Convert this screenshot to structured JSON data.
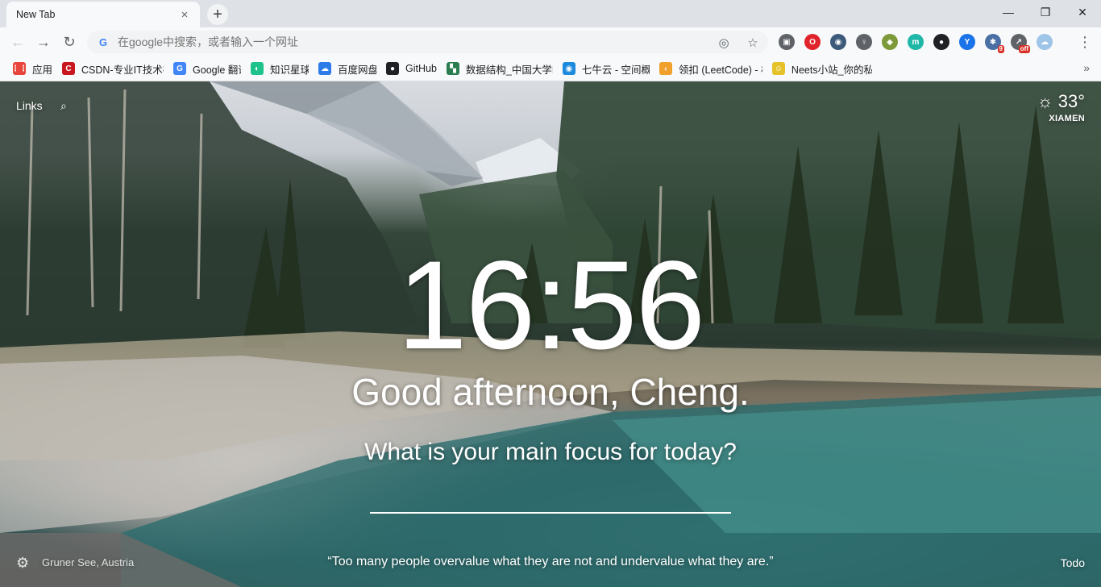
{
  "tab": {
    "title": "New Tab",
    "close_icon": "×",
    "new_tab_icon": "+"
  },
  "window": {
    "minimize": "—",
    "restore": "❐",
    "close": "✕"
  },
  "toolbar": {
    "back_icon": "←",
    "forward_icon": "→",
    "reload_icon": "↻",
    "omnibox_placeholder": "在google中搜索，或者输入一个网址",
    "google_g": "G",
    "location_icon": "◎",
    "bookmark_star_icon": "☆",
    "menu_icon": "⋮",
    "extensions": [
      {
        "name": "extension-1",
        "glyph": "▣",
        "color": "#5f6368"
      },
      {
        "name": "opera-extension",
        "glyph": "O",
        "color": "#e0242b"
      },
      {
        "name": "extension-3",
        "glyph": "◉",
        "color": "#3c5a7a"
      },
      {
        "name": "extension-4",
        "glyph": "♀",
        "color": "#5f6368"
      },
      {
        "name": "extension-5",
        "glyph": "◆",
        "color": "#7c9a3a"
      },
      {
        "name": "extension-6",
        "glyph": "m",
        "color": "#1fb8a8"
      },
      {
        "name": "extension-7",
        "glyph": "●",
        "color": "#202124"
      },
      {
        "name": "extension-8",
        "glyph": "Y",
        "color": "#1a73e8"
      },
      {
        "name": "extension-9",
        "glyph": "✱",
        "color": "#4a6fa5",
        "badge": "9"
      },
      {
        "name": "extension-10",
        "glyph": "↗",
        "color": "#5f6368",
        "badge": "off"
      },
      {
        "name": "extension-11",
        "glyph": "☁",
        "color": "#9ec5e8"
      }
    ]
  },
  "bookmarks": {
    "items": [
      {
        "label": "应用",
        "icon": "⋮⋮",
        "color": "#e8453c"
      },
      {
        "label": "CSDN-专业IT技术社区",
        "icon": "C",
        "color": "#c9171e"
      },
      {
        "label": "Google 翻译",
        "icon": "G",
        "color": "#4285f4"
      },
      {
        "label": "知识星球",
        "icon": "◐",
        "color": "#1ec28b"
      },
      {
        "label": "百度网盘",
        "icon": "☁",
        "color": "#2d7be8"
      },
      {
        "label": "GitHub",
        "icon": "●",
        "color": "#202124"
      },
      {
        "label": "数据结构_中国大学MOOC",
        "icon": "▚",
        "color": "#2a7d4f"
      },
      {
        "label": "七牛云 - 空间概览",
        "icon": "◉",
        "color": "#1c8bde"
      },
      {
        "label": "领扣 (LeetCode) - 极",
        "icon": "‹",
        "color": "#f0a02b"
      },
      {
        "label": "Neets小站_你的私人",
        "icon": "☺",
        "color": "#e6c229"
      }
    ],
    "more_icon": "»"
  },
  "momentum": {
    "links_label": "Links",
    "search_icon": "⌕",
    "weather": {
      "icon": "☼",
      "temperature": "33°",
      "city": "XIAMEN"
    },
    "clock": "16:56",
    "greeting": "Good afternoon, Cheng.",
    "focus_question": "What is your main focus for today?",
    "focus_value": "",
    "settings_icon": "⚙",
    "photo_location": "Gruner See, Austria",
    "quote": "“Too many people overvalue what they are not and undervalue what they are.”",
    "todo_label": "Todo"
  }
}
